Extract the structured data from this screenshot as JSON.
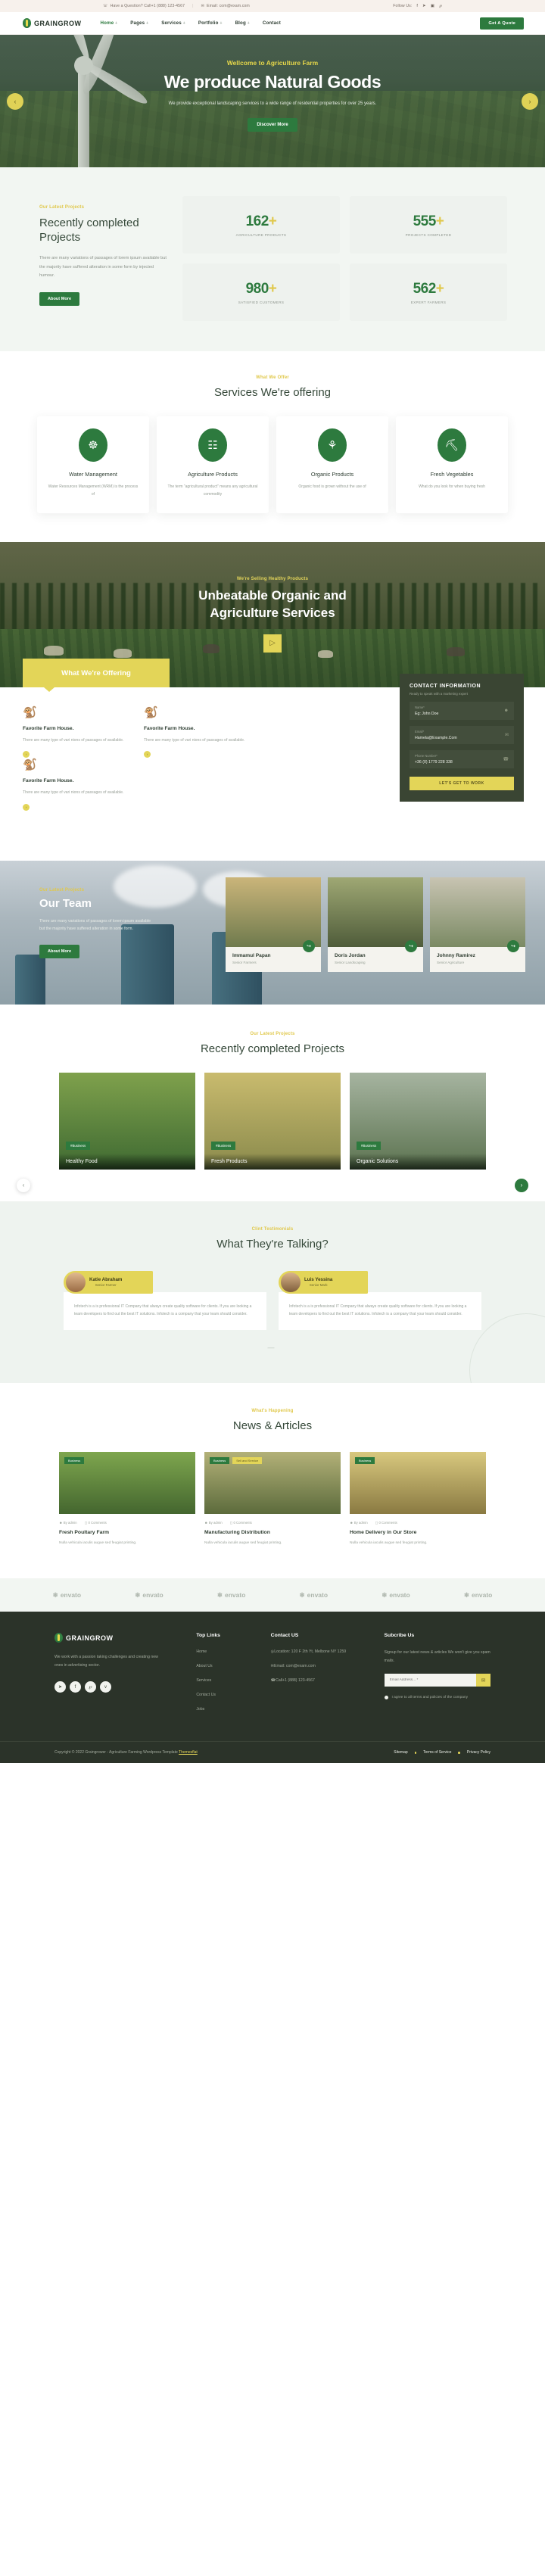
{
  "topbar": {
    "phone_icon": "phone-icon",
    "phone": "Have a Question? Call+1 (888) 123-4567",
    "mail_icon": "mail-icon",
    "email": "Email: com@exam.com",
    "follow_label": "Follow Us:",
    "socials": [
      "facebook-icon",
      "twitter-icon",
      "instagram-icon",
      "pinterest-icon"
    ],
    "social_glyphs": [
      "f",
      "✉",
      "▣",
      "℘"
    ]
  },
  "nav": {
    "brand": "GRAINGROW",
    "items": [
      {
        "label": "Home",
        "caret": "+",
        "active": true
      },
      {
        "label": "Pages",
        "caret": "+",
        "active": false
      },
      {
        "label": "Services",
        "caret": "+",
        "active": false
      },
      {
        "label": "Portfolio",
        "caret": "+",
        "active": false
      },
      {
        "label": "Blog",
        "caret": "+",
        "active": false
      },
      {
        "label": "Contact",
        "caret": "",
        "active": false
      }
    ],
    "cta": "Get A Quote"
  },
  "hero": {
    "eyebrow": "Wellcome to Agriculture Farm",
    "title": "We produce Natural Goods",
    "subtitle": "We provide exceptional landscaping services to a wide range of residential properties for over 25 years.",
    "button": "Discover More",
    "prev": "‹",
    "next": "›"
  },
  "projects": {
    "eyebrow": "Our Latest Projects",
    "title": "Recently completed Projects",
    "body": "There are many variations of passages of lorem ipsum available but the majority have suffered alteration in some form by injected humour.",
    "button": "About More",
    "stats": [
      {
        "value": "162",
        "plus": "+",
        "label": "AGRICULTURE PRODUCTS"
      },
      {
        "value": "555",
        "plus": "+",
        "label": "PROJECTS COMPLETED"
      },
      {
        "value": "980",
        "plus": "+",
        "label": "SATISFIED CUSTOMERS"
      },
      {
        "value": "562",
        "plus": "+",
        "label": "EXPERT FARMERS"
      }
    ]
  },
  "services": {
    "eyebrow": "What We Offer",
    "title": "Services We're offering",
    "cards": [
      {
        "icon": "water-drop-icon",
        "glyph": "☸",
        "title": "Water Management",
        "text": "Water Resources Management (WRM) is the process of"
      },
      {
        "icon": "irrigation-icon",
        "glyph": "☷",
        "title": "Agriculture Products",
        "text": "The term “agricultural product” means any agricultural commodity"
      },
      {
        "icon": "plant-icon",
        "glyph": "⚘",
        "title": "Organic Products",
        "text": "Organic food is grown without the use of"
      },
      {
        "icon": "shovel-icon",
        "glyph": "⛏",
        "title": "Fresh Vegetables",
        "text": "What do you look for when buying fresh"
      }
    ]
  },
  "organic": {
    "eyebrow": "We're Selling Healthy Products",
    "title_line1": "Unbeatable Organic and",
    "title_line2": "Agriculture Services",
    "play_icon": "play-icon",
    "play_glyph": "▷"
  },
  "offering": {
    "heading": "What We're Offering",
    "items": [
      {
        "icon": "goose-icon",
        "glyph": "🪿",
        "title": "Favorite Farm House.",
        "text": "There are many type of vari nions of passages of available.",
        "arrow": "›"
      },
      {
        "icon": "goose-icon",
        "glyph": "🪿",
        "title": "Favorite Farm House.",
        "text": "There are many type of vari nions of passages of available.",
        "arrow": "›"
      },
      {
        "icon": "goose-icon",
        "glyph": "🪿",
        "title": "Favorite Farm House.",
        "text": "There are many type of vari nions of passages of available.",
        "arrow": "›"
      }
    ]
  },
  "contact": {
    "title": "CONTACT INFORMATION",
    "subtitle": "Ready to speak with a marketing expert",
    "fields": [
      {
        "label": "Name*",
        "value": "Eg: John Doe",
        "icon": "user-icon",
        "glyph": "☺"
      },
      {
        "label": "Email*",
        "value": "Hamela@Example.Com",
        "icon": "mail-icon",
        "glyph": "✉"
      },
      {
        "label": "Phone Number*",
        "value": "+36 (0) 1779 228 338",
        "icon": "phone-icon",
        "glyph": "☎"
      }
    ],
    "button": "LET'S GET TO WORK"
  },
  "team": {
    "eyebrow": "Our Latest Projects",
    "title": "Our Team",
    "body": "There are many variations of passages of lorem ipsum available but the majority have suffered alteration in some form.",
    "button": "About More",
    "members": [
      {
        "name": "Immamul Papan",
        "role": "Senior Farmers",
        "share_icon": "share-icon",
        "share_glyph": "↪"
      },
      {
        "name": "Doris Jordan",
        "role": "Senior Landscaping",
        "share_icon": "share-icon",
        "share_glyph": "↪"
      },
      {
        "name": "Johnny Ramirez",
        "role": "Senior Agriculture",
        "share_icon": "share-icon",
        "share_glyph": "↪"
      }
    ]
  },
  "gallery": {
    "eyebrow": "Our Latest Projects",
    "title": "Recently completed Projects",
    "prev": "‹",
    "next": "›",
    "cards": [
      {
        "tag": "#Business",
        "caption": "Healthy Food"
      },
      {
        "tag": "#Business",
        "caption": "Fresh Products"
      },
      {
        "tag": "#Business",
        "caption": "Organic Solutions"
      }
    ]
  },
  "testimonials": {
    "eyebrow": "Clint Testimonials",
    "title": "What They're Talking?",
    "dots": "—",
    "items": [
      {
        "name": "Katie Abraham",
        "role": "Senior Farmer",
        "text": "Infotech is a is professional IT Company that always create quality software for clients. If you are looking a team developers to find out the best IT solutions. Infotech is a company that your team should consider."
      },
      {
        "name": "Luis Yessina",
        "role": "Senior Mark",
        "text": "Infotech is a is professional IT Company that always create quality software for clients. If you are looking a team developers to find out the best IT solutions. Infotech is a company that your team should consider."
      }
    ]
  },
  "news": {
    "eyebrow": "What's Happening",
    "title": "News & Articles",
    "cards": [
      {
        "badges": [
          {
            "text": "Business",
            "style": "green"
          }
        ],
        "author_icon": "user-icon",
        "author": "By admin",
        "comment_icon": "comment-icon",
        "comments": "0 Comments",
        "title": "Fresh Poultary Farm",
        "text": "Nulla vehicula iaculis augue sed feugiat printing."
      },
      {
        "badges": [
          {
            "text": "Business",
            "style": "green"
          },
          {
            "text": "Sell and Service",
            "style": "yellow"
          }
        ],
        "author_icon": "user-icon",
        "author": "By admin",
        "comment_icon": "comment-icon",
        "comments": "0 Comments",
        "title": "Manufacturing Distribution",
        "text": "Nulla vehicula iaculis augue sed feugiat printing."
      },
      {
        "badges": [
          {
            "text": "Business",
            "style": "green"
          }
        ],
        "author_icon": "user-icon",
        "author": "By admin",
        "comment_icon": "comment-icon",
        "comments": "0 Comments",
        "title": "Home Delivery in Our Store",
        "text": "Nulla vehicula iaculis augue sed feugiat printing."
      }
    ]
  },
  "brands": {
    "items": [
      "envato",
      "envato",
      "envato",
      "envato",
      "envato",
      "envato"
    ]
  },
  "footer": {
    "brand": "GRAINGROW",
    "about": "We work with a passion taking challenges and creating new ones in advertising sector.",
    "socials": [
      "twitter-icon",
      "facebook-icon",
      "pinterest-icon",
      "vimeo-icon"
    ],
    "social_glyphs": [
      "✉",
      "f",
      "℘",
      "v"
    ],
    "links_title": "Top Links",
    "links": [
      "Home",
      "About Us",
      "Services",
      "Contact Us",
      "Jobs"
    ],
    "contact_title": "Contact US",
    "contact_lines": [
      {
        "icon": "location-icon",
        "glyph": "◎",
        "text": "Location: 120 F 2th Yt, Melbone NY 1259"
      },
      {
        "icon": "mail-icon",
        "glyph": "✉",
        "text": "Email: com@exam.com"
      },
      {
        "icon": "phone-icon",
        "glyph": "☎",
        "text": "Call+1 (888) 123-4567"
      }
    ],
    "subscribe_title": "Subcribe Us",
    "subscribe_text": "Signup for our latest news & articles We won't give you spam mails.",
    "email_placeholder": "Email Address... *",
    "send_icon": "send-mail-icon",
    "send_glyph": "✉",
    "agree_text": "I agree to all terms and policies of the company",
    "copyright_pre": "Copyright © 2022 Graingrower - Agriculture Farming Wordpress Template ",
    "copyright_link": "Themesflat",
    "bottom_links": [
      "Sitemap",
      "Terms of Service",
      "Privacy Policy"
    ]
  },
  "colors": {
    "green": "#2d7a3e",
    "yellow": "#e3d558",
    "dark": "#2b3329",
    "light_bg": "#f2f6f2"
  }
}
